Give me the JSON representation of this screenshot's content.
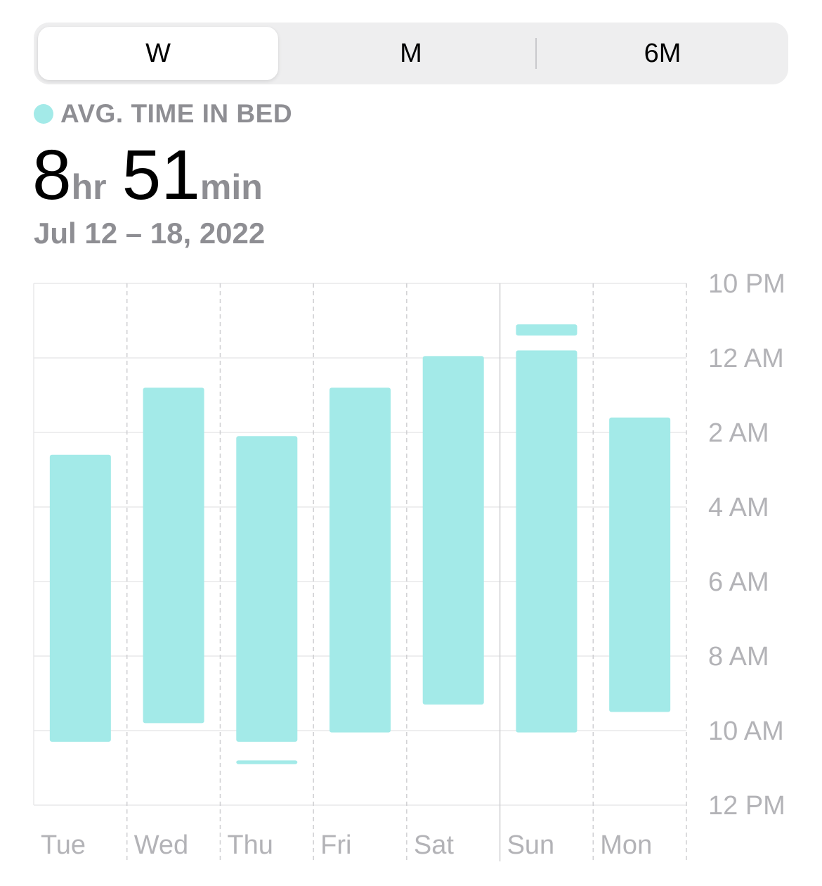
{
  "segmented_control": {
    "options": [
      "W",
      "M",
      "6M"
    ],
    "selected": "W"
  },
  "summary": {
    "label": "AVG. TIME IN BED",
    "hours_value": "8",
    "hours_unit": "hr",
    "minutes_value": "51",
    "minutes_unit": "min",
    "date_range": "Jul 12 – 18, 2022"
  },
  "colors": {
    "bar": "#a3eae8",
    "gridline": "#e8e8ea",
    "axis_text": "#b3b3b7",
    "secondary_text": "#8e8e93"
  },
  "chart_data": {
    "type": "bar",
    "orientation": "vertical-range",
    "categories": [
      "Tue",
      "Wed",
      "Thu",
      "Fri",
      "Sat",
      "Sun",
      "Mon"
    ],
    "y_ticks": [
      "10 PM",
      "12 AM",
      "2 AM",
      "4 AM",
      "6 AM",
      "8 AM",
      "10 AM",
      "12 PM"
    ],
    "y_range_hours_after_10pm": [
      0,
      14
    ],
    "grid": true,
    "series": [
      {
        "segments": [
          [
            [
              4.6,
              12.3
            ]
          ],
          [
            [
              2.8,
              11.8
            ]
          ],
          [
            [
              4.1,
              12.3
            ],
            [
              12.8,
              12.9
            ]
          ],
          [
            [
              2.8,
              12.05
            ]
          ],
          [
            [
              1.95,
              11.3
            ]
          ],
          [
            [
              1.1,
              1.4
            ],
            [
              1.8,
              12.05
            ]
          ],
          [
            [
              3.6,
              11.5
            ]
          ]
        ]
      }
    ]
  }
}
